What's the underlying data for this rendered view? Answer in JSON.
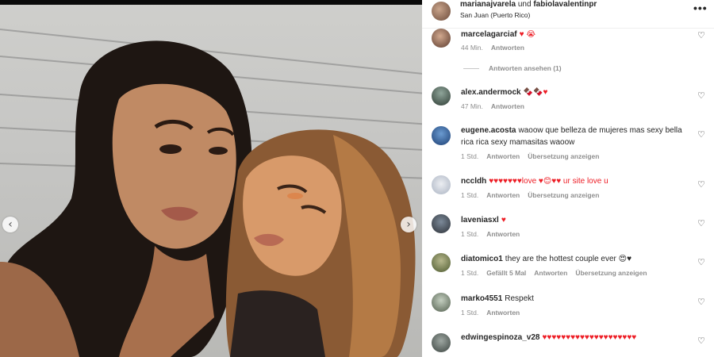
{
  "header": {
    "user1": "marianajvarela",
    "conj": "und",
    "user2": "fabiolavalentinpr",
    "location": "San Juan (Puerto Rico)",
    "more_label": "•••"
  },
  "carousel": {
    "prev": "‹",
    "next": "›"
  },
  "colors": {
    "heart": "#ed1c24",
    "meta": "#8e8e8e",
    "text": "#262626"
  },
  "replies_label": "Antworten ansehen (1)",
  "comments": [
    {
      "user": "marcelagarciaf",
      "text": "♥ 😭",
      "meta": [
        "44 Min.",
        "Antworten"
      ]
    },
    {
      "user": "alex.andermock",
      "text": "🍫🍫♥",
      "meta": [
        "47 Min.",
        "Antworten"
      ]
    },
    {
      "user": "eugene.acosta",
      "text": "waoow que belleza de mujeres mas sexy bella rica rica sexy mamasitas waoow",
      "meta": [
        "1 Std.",
        "Antworten",
        "Übersetzung anzeigen"
      ]
    },
    {
      "user": "nccldh",
      "text": "♥♥♥♥♥♥♥love ♥😊♥♥ ur site love u",
      "meta": [
        "1 Std.",
        "Antworten",
        "Übersetzung anzeigen"
      ]
    },
    {
      "user": "laveniasxl",
      "text": "♥",
      "meta": [
        "1 Std.",
        "Antworten"
      ]
    },
    {
      "user": "diatomico1",
      "text": "they are the hottest couple ever 😍♥",
      "meta": [
        "1 Std.",
        "Gefällt 5 Mal",
        "Antworten",
        "Übersetzung anzeigen"
      ]
    },
    {
      "user": "marko4551",
      "text": "Respekt",
      "meta": [
        "1 Std.",
        "Antworten"
      ]
    },
    {
      "user": "edwingespinoza_v28",
      "text": "♥♥♥♥♥♥♥♥♥♥♥♥♥♥♥♥♥♥♥♥",
      "meta": []
    }
  ]
}
